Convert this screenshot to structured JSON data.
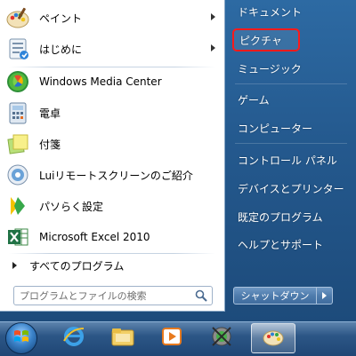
{
  "start_menu": {
    "programs": [
      {
        "label": "ペイント",
        "has_submenu": true,
        "icon": "paint-icon"
      },
      {
        "label": "はじめに",
        "has_submenu": true,
        "icon": "getting-started-icon"
      },
      {
        "label": "Windows Media Center",
        "has_submenu": false,
        "icon": "media-center-icon"
      },
      {
        "label": "電卓",
        "has_submenu": false,
        "icon": "calculator-icon"
      },
      {
        "label": "付箋",
        "has_submenu": false,
        "icon": "sticky-notes-icon"
      },
      {
        "label": "Luiリモートスクリーンのご紹介",
        "has_submenu": false,
        "icon": "remote-screen-icon"
      },
      {
        "label": "パソらく設定",
        "has_submenu": false,
        "icon": "pasoraku-icon"
      },
      {
        "label": "Microsoft Excel 2010",
        "has_submenu": false,
        "icon": "excel-icon"
      }
    ],
    "all_programs_label": "すべてのプログラム",
    "search": {
      "placeholder": "プログラムとファイルの検索"
    },
    "right_items": [
      {
        "label": "ドキュメント",
        "highlighted": false
      },
      {
        "label": "ピクチャ",
        "highlighted": true
      },
      {
        "label": "ミュージック",
        "highlighted": false
      },
      {
        "label": "ゲーム",
        "highlighted": false
      },
      {
        "label": "コンピューター",
        "highlighted": false
      },
      {
        "label": "コントロール パネル",
        "highlighted": false
      },
      {
        "label": "デバイスとプリンター",
        "highlighted": false
      },
      {
        "label": "既定のプログラム",
        "highlighted": false
      },
      {
        "label": "ヘルプとサポート",
        "highlighted": false
      }
    ],
    "shutdown_label": "シャットダウン"
  },
  "taskbar": {
    "buttons": [
      {
        "name": "internet-explorer",
        "icon": "internet-explorer-icon",
        "active": false
      },
      {
        "name": "windows-explorer",
        "icon": "folder-icon",
        "active": false
      },
      {
        "name": "media-player",
        "icon": "media-player-icon",
        "active": false
      },
      {
        "name": "games",
        "icon": "games-icon",
        "active": false
      },
      {
        "name": "paint",
        "icon": "paint-icon",
        "active": true
      }
    ]
  },
  "colors": {
    "highlight_border": "#ff1a1a",
    "menu_blue": "#24598e"
  }
}
